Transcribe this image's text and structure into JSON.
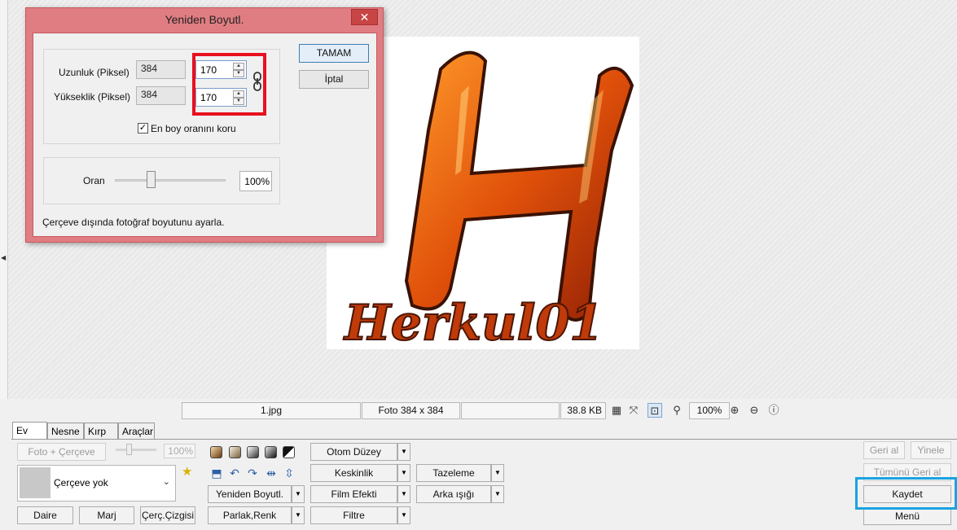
{
  "dialog": {
    "title": "Yeniden Boyutl.",
    "close_glyph": "✕",
    "width_label": "Uzunluk (Piksel)",
    "height_label": "Yükseklik (Piksel)",
    "width_current": "384",
    "height_current": "384",
    "width_new": "170",
    "height_new": "170",
    "aspect_label": "En boy oranını koru",
    "aspect_checked": true,
    "ratio_label": "Oran",
    "ratio_value": "100%",
    "ok_label": "TAMAM",
    "cancel_label": "İptal",
    "hint": "Çerçeve dışında fotoğraf boyutunu ayarla.",
    "highlight_color": "#e8101e"
  },
  "status_bar": {
    "filename": "1.jpg",
    "dimensions": "Foto 384 x 384",
    "file_size": "38.8 KB",
    "zoom": "100%"
  },
  "tabs": [
    "Ev",
    "Nesne",
    "Kırp",
    "Araçlar"
  ],
  "toolbar": {
    "photo_frame_label": "Foto + Çerçeve",
    "opacity_value": "100%",
    "frame_select_value": "Çerçeve yok",
    "circle_label": "Daire",
    "margin_label": "Marj",
    "frame_line_label": "Çerç.Çizgisi",
    "resize_label": "Yeniden Boyutl.",
    "brightness_label": "Parlak,Renk",
    "auto_level_label": "Otom Düzey",
    "sharpness_label": "Keskinlik",
    "film_effect_label": "Film Efekti",
    "filter_label": "Filtre",
    "refresh_label": "Tazeleme",
    "backlight_label": "Arka ışığı",
    "undo_label": "Geri al",
    "redo_label": "Yinele",
    "undo_all_label": "Tümünü Geri al",
    "save_label": "Kaydet",
    "menu_label": "Menü",
    "save_highlight_color": "#1aa3e0"
  },
  "photo": {
    "caption": "Herkul01"
  }
}
